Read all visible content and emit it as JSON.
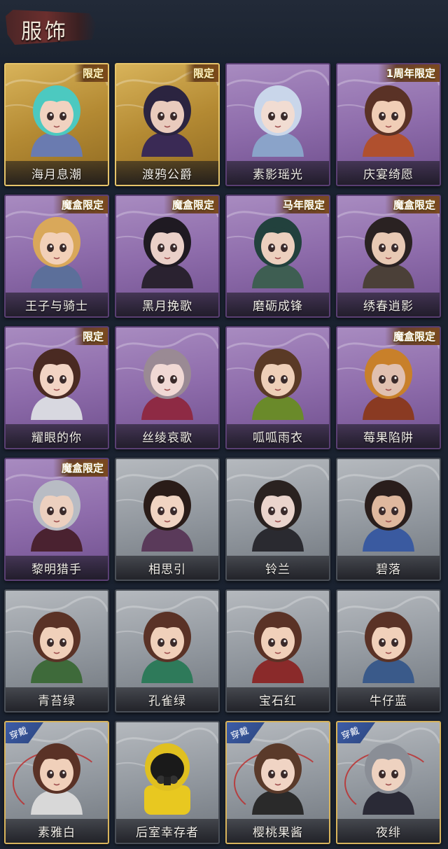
{
  "header": {
    "title": "服饰"
  },
  "cards": [
    {
      "name": "海月息潮",
      "tag": "限定",
      "frame": "gold",
      "hair": "#4cc9c0",
      "skin": "#f1d2c0",
      "outfit": "#6a7bb0"
    },
    {
      "name": "渡鸦公爵",
      "tag": "限定",
      "frame": "gold",
      "hair": "#2b2440",
      "skin": "#e9cbbd",
      "outfit": "#3a2a55"
    },
    {
      "name": "素影瑶光",
      "tag": "",
      "frame": "purple",
      "hair": "#c9d6ea",
      "skin": "#f1dcd2",
      "outfit": "#8aa3c9"
    },
    {
      "name": "庆宴绮愿",
      "tag": "1周年限定",
      "frame": "purple",
      "hair": "#5a3226",
      "skin": "#f0cdb6",
      "outfit": "#b0502e"
    },
    {
      "name": "王子与骑士",
      "tag": "魔盒限定",
      "frame": "purple",
      "hair": "#d9a85a",
      "skin": "#f2d0b8",
      "outfit": "#5c6f9a"
    },
    {
      "name": "黑月挽歌",
      "tag": "魔盒限定",
      "frame": "purple",
      "hair": "#1f1a22",
      "skin": "#ead0c8",
      "outfit": "#2a2230"
    },
    {
      "name": "磨砺成锋",
      "tag": "马年限定",
      "frame": "purple",
      "hair": "#22413d",
      "skin": "#ecd0be",
      "outfit": "#3e5e52"
    },
    {
      "name": "绣春逍影",
      "tag": "魔盒限定",
      "frame": "purple",
      "hair": "#2a2222",
      "skin": "#e8c9b4",
      "outfit": "#4b4038"
    },
    {
      "name": "耀眼的你",
      "tag": "限定",
      "frame": "purple",
      "hair": "#4a2a22",
      "skin": "#f2d4c4",
      "outfit": "#d8d8e0"
    },
    {
      "name": "丝绫哀歌",
      "tag": "",
      "frame": "purple",
      "hair": "#9a8a94",
      "skin": "#f0d8d4",
      "outfit": "#8e2a44"
    },
    {
      "name": "呱呱雨衣",
      "tag": "",
      "frame": "purple",
      "hair": "#5a3a26",
      "skin": "#eecfb8",
      "outfit": "#6a8a2a"
    },
    {
      "name": "莓果陷阱",
      "tag": "魔盒限定",
      "frame": "purple",
      "hair": "#c8802a",
      "skin": "#e0c0b0",
      "outfit": "#8a3a22"
    },
    {
      "name": "黎明猎手",
      "tag": "魔盒限定",
      "frame": "purple",
      "hair": "#b8bcc4",
      "skin": "#ecd0bf",
      "outfit": "#4a2230"
    },
    {
      "name": "相思引",
      "tag": "",
      "frame": "gray",
      "hair": "#2a1c18",
      "skin": "#f0d4c2",
      "outfit": "#5a3a5a"
    },
    {
      "name": "铃兰",
      "tag": "",
      "frame": "gray",
      "hair": "#2a2220",
      "skin": "#ead4cc",
      "outfit": "#2a2a30"
    },
    {
      "name": "碧落",
      "tag": "",
      "frame": "gray",
      "hair": "#2a1e1c",
      "skin": "#dfb89e",
      "outfit": "#3a5aa0"
    },
    {
      "name": "青苔绿",
      "tag": "",
      "frame": "gray",
      "hair": "#5a3226",
      "skin": "#f0d0ba",
      "outfit": "#3e6a3a"
    },
    {
      "name": "孔雀绿",
      "tag": "",
      "frame": "gray",
      "hair": "#5a3226",
      "skin": "#f0d0ba",
      "outfit": "#2e7a5a"
    },
    {
      "name": "宝石红",
      "tag": "",
      "frame": "gray",
      "hair": "#5a3226",
      "skin": "#f0d0ba",
      "outfit": "#8a2a2a"
    },
    {
      "name": "牛仔蓝",
      "tag": "",
      "frame": "gray",
      "hair": "#5a3226",
      "skin": "#f0d0ba",
      "outfit": "#3a5a8a"
    },
    {
      "name": "素雅白",
      "tag": "",
      "frame": "gray",
      "worn": "穿戴",
      "hair": "#5a3226",
      "skin": "#f0d0ba",
      "outfit": "#d8d8d8"
    },
    {
      "name": "后室幸存者",
      "tag": "",
      "frame": "gray",
      "hair": "#e0c020",
      "skin": "#1a1a1a",
      "outfit": "#e8c820"
    },
    {
      "name": "樱桃果酱",
      "tag": "",
      "frame": "gray",
      "worn": "穿戴",
      "hair": "#5a3a2a",
      "skin": "#f0d4c4",
      "outfit": "#2a2a2a"
    },
    {
      "name": "夜绯",
      "tag": "",
      "frame": "gray",
      "worn": "穿戴",
      "hair": "#8a8e96",
      "skin": "#eed2c0",
      "outfit": "#2a2a36"
    }
  ]
}
